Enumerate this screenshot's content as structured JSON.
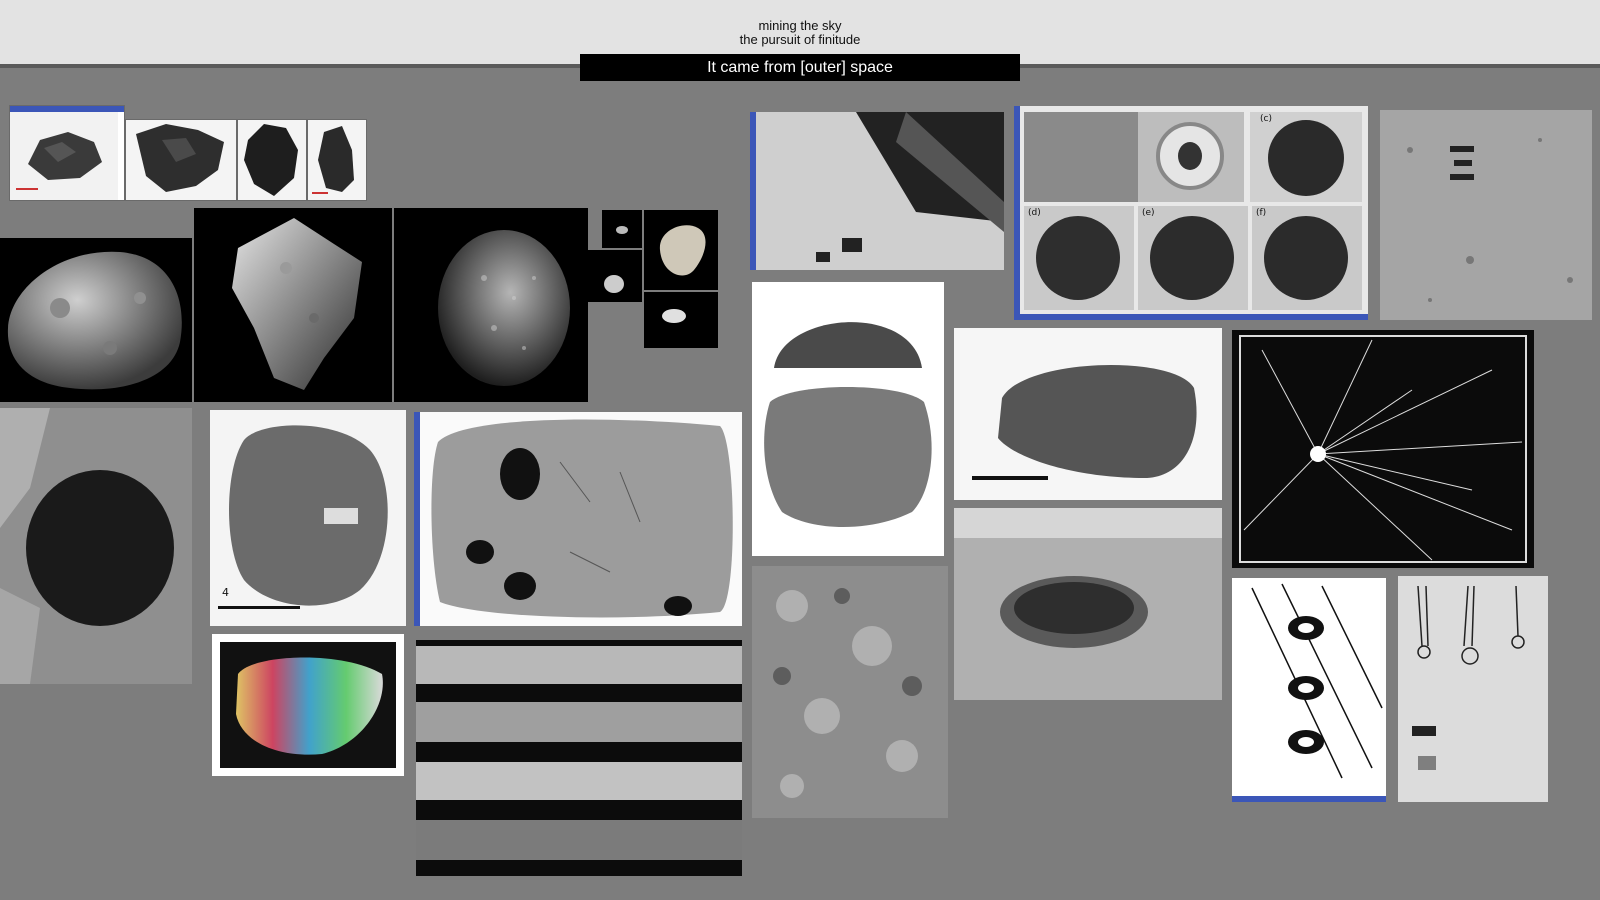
{
  "header": {
    "line1": "mining the sky",
    "line2": "the pursuit of finitude",
    "section_title": "It came from [outer] space"
  },
  "moodboard": {
    "tiles": [
      {
        "name": "meteorite-fragment-1"
      },
      {
        "name": "meteorite-fragment-2"
      },
      {
        "name": "meteorite-fragment-3"
      },
      {
        "name": "meteorite-fragment-4"
      },
      {
        "name": "phobos-moon-photo"
      },
      {
        "name": "asteroid-gray-photo"
      },
      {
        "name": "asteroid-rubble-photo"
      },
      {
        "name": "small-asteroids-collage"
      },
      {
        "name": "lander-shadow-photo"
      },
      {
        "name": "sample-containers-photo",
        "panel_labels": [
          "(c)",
          "(d)",
          "(e)",
          "(f)"
        ]
      },
      {
        "name": "asteroid-surface-grainy-photo"
      },
      {
        "name": "crater-pit-photo"
      },
      {
        "name": "meteorite-specimen-4",
        "label": "4"
      },
      {
        "name": "meteorite-slab-photo"
      },
      {
        "name": "tektite-dome-photo"
      },
      {
        "name": "tektite-side-photo"
      },
      {
        "name": "meteor-radiant-chart"
      },
      {
        "name": "iridescent-fragment-photo"
      },
      {
        "name": "drill-core-samples-photo"
      },
      {
        "name": "rock-texture-photo"
      },
      {
        "name": "lunar-crater-aerial-photo"
      },
      {
        "name": "comet-drawings"
      },
      {
        "name": "chinese-comet-atlas"
      }
    ]
  }
}
